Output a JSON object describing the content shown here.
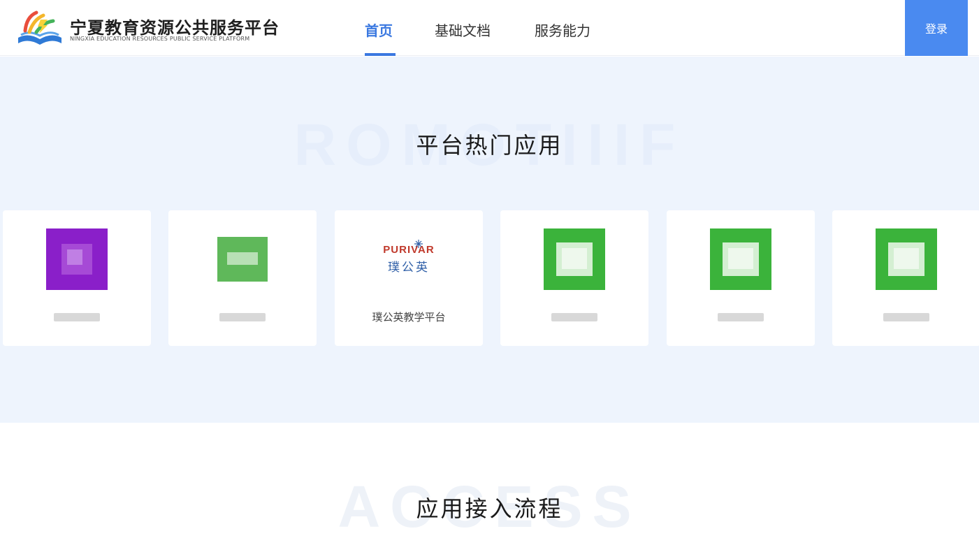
{
  "header": {
    "brand_cn": "宁夏教育资源公共服务平台",
    "brand_en": "NINGXIA EDUCATION RESOURCES PUBLIC SERVICE PLATFORM",
    "logo_icon": "education-book-logo-icon",
    "accent_color": "#3a78e0",
    "nav": [
      {
        "label": "首页",
        "active": true
      },
      {
        "label": "基础文档",
        "active": false
      },
      {
        "label": "服务能力",
        "active": false
      }
    ],
    "login_label": "登录",
    "login_color": "#4a8af0"
  },
  "hot_apps": {
    "title": "平台热门应用",
    "watermark": "ROMOTIIIF",
    "background": "#eef4fd",
    "apps": [
      {
        "label": "",
        "icon": "blurred-purple-app-icon"
      },
      {
        "label": "",
        "icon": "blurred-green-app-icon"
      },
      {
        "label": "璞公英教学平台",
        "icon": "purivar-logo-icon",
        "logo_en": "PURIVAR",
        "logo_cn": "璞公英"
      },
      {
        "label": "",
        "icon": "blurred-green-app-icon"
      },
      {
        "label": "",
        "icon": "blurred-green-app-icon"
      },
      {
        "label": "",
        "icon": "blurred-green-app-icon"
      }
    ]
  },
  "access": {
    "title": "应用接入流程",
    "watermark": "ACCESS"
  }
}
